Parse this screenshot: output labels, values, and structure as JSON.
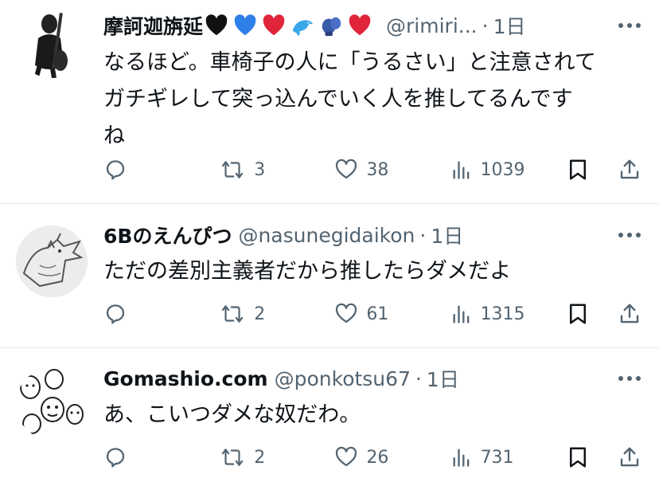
{
  "tweets": [
    {
      "name": "摩訶迦旃延",
      "emoji": [
        "black-heart",
        "blue-heart",
        "red-heart",
        "dolphin",
        "boxing-glove",
        "red-heart"
      ],
      "handle": "@rimiri...",
      "dot": "·",
      "time": "1日",
      "text": "なるほど。車椅子の人に「うるさい」と注意されて\nガチギレして突っ込んでいく人を推してるんです\nね",
      "replies": "",
      "retweets": "3",
      "likes": "38",
      "views": "1039"
    },
    {
      "name": "6Bのえんぴつ",
      "emoji": [],
      "handle": "@nasunegidaikon",
      "dot": "·",
      "time": "1日",
      "text": "ただの差別主義者だから推したらダメだよ",
      "replies": "",
      "retweets": "2",
      "likes": "61",
      "views": "1315"
    },
    {
      "name": "Gomashio.com",
      "emoji": [],
      "handle": "@ponkotsu67",
      "dot": "·",
      "time": "1日",
      "text": "あ、こいつダメな奴だわ。",
      "replies": "",
      "retweets": "2",
      "likes": "26",
      "views": "731"
    }
  ],
  "icons": {
    "reply": "reply-icon",
    "retweet": "retweet-icon",
    "like": "heart-icon",
    "views": "views-icon",
    "bookmark": "bookmark-icon",
    "share": "share-icon",
    "more": "more-icon"
  },
  "colors": {
    "text": "#0f1419",
    "secondary": "#536471",
    "divider": "#e6ecf0",
    "red_heart": "#e0243a",
    "blue_heart": "#2f7fe8"
  }
}
